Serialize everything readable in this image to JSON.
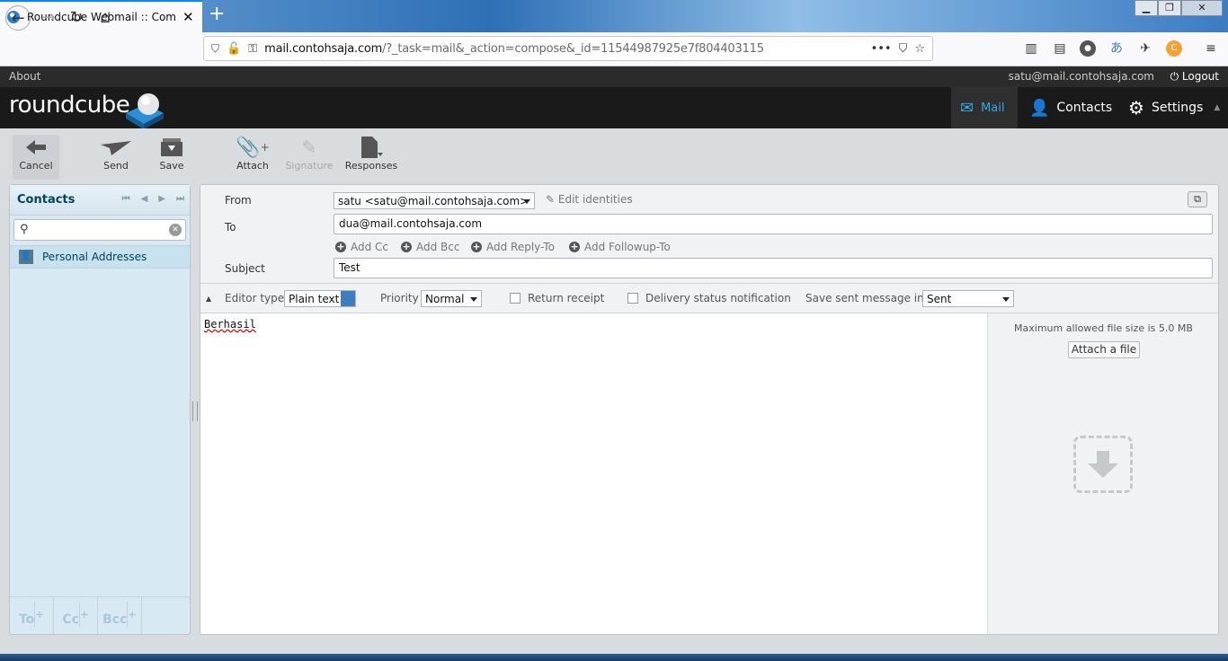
{
  "browser": {
    "tab_title": "Roundcube Webmail :: Compo",
    "url_host": "mail.contohsaja.com",
    "url_path": "/?_task=mail&_action=compose&_id=11544987925e7f804403115",
    "url_prefix": "mail."
  },
  "topline": {
    "about": "About",
    "user": "satu@mail.contohsaja.com",
    "logout": "Logout"
  },
  "logo_text": "roundcube",
  "tasks": {
    "mail": "Mail",
    "contacts": "Contacts",
    "settings": "Settings"
  },
  "toolbar": {
    "cancel": "Cancel",
    "send": "Send",
    "save": "Save",
    "attach": "Attach",
    "signature": "Signature",
    "responses": "Responses"
  },
  "sidebar": {
    "title": "Contacts",
    "search_placeholder": "",
    "items": [
      {
        "label": "Personal Addresses"
      }
    ],
    "footer": {
      "to": "To",
      "cc": "Cc",
      "bcc": "Bcc"
    }
  },
  "compose": {
    "from_label": "From",
    "from_value": "satu <satu@mail.contohsaja.com>",
    "edit_identities": "Edit identities",
    "to_label": "To",
    "to_value": "dua@mail.contohsaja.com",
    "add_cc": "Add Cc",
    "add_bcc": "Add Bcc",
    "add_reply_to": "Add Reply-To",
    "add_followup_to": "Add Followup-To",
    "subject_label": "Subject",
    "subject_value": "Test",
    "editor_type_label": "Editor type",
    "editor_type_value": "Plain text",
    "priority_label": "Priority",
    "priority_value": "Normal",
    "return_receipt": "Return receipt",
    "dsn": "Delivery status notification",
    "save_sent_label": "Save sent message in",
    "save_sent_value": "Sent",
    "body": "Berhasil"
  },
  "attachments": {
    "max_size_hint": "Maximum allowed file size is 5.0 MB",
    "attach_file": "Attach a file"
  },
  "colors": {
    "accent": "#35a8e6",
    "header_bg": "#1a1a1a",
    "sidebar_bg": "#d8e9f3"
  }
}
